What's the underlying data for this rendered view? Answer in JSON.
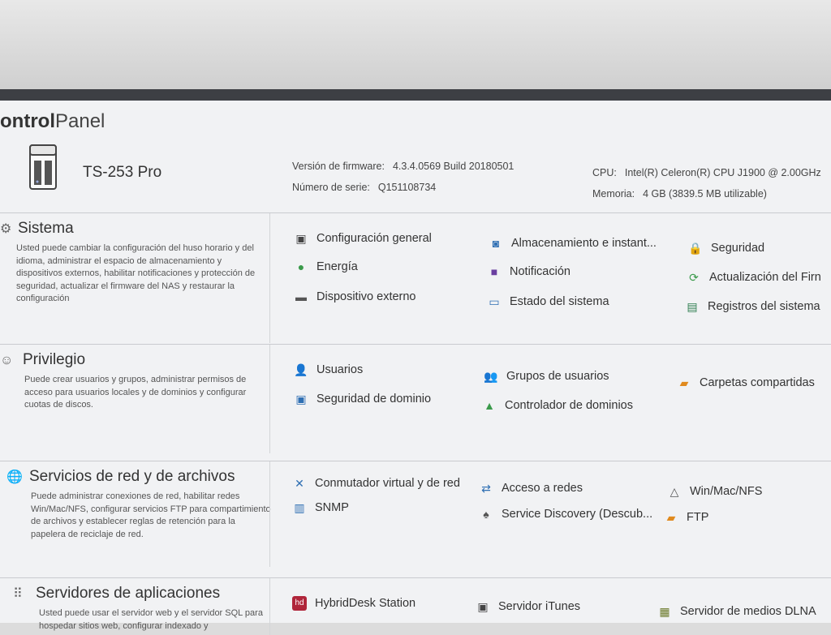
{
  "app": {
    "title_bold": "ontrol",
    "title_rest": "Panel"
  },
  "device": {
    "model": "TS-253 Pro",
    "firmware_label": "Versión de firmware:",
    "firmware_value": "4.3.4.0569 Build 20180501",
    "serial_label": "Número de serie:",
    "serial_value": "Q151108734",
    "cpu_label": "CPU:",
    "cpu_value": "Intel(R) Celeron(R) CPU J1900 @ 2.00GHz",
    "memory_label": "Memoria:",
    "memory_value": "4 GB (3839.5 MB utilizable)"
  },
  "sections": {
    "sistema": {
      "title": "Sistema",
      "desc": "Usted puede cambiar la configuración del huso horario y del idioma, administrar el espacio de almacenamiento y dispositivos externos, habilitar notificaciones y protección de seguridad, actualizar el firmware del NAS y restaurar la configuración",
      "items": [
        "Configuración general",
        "Almacenamiento e instant...",
        "Seguridad",
        "Energía",
        "Notificación",
        "Actualización del Firn",
        "Dispositivo externo",
        "Estado del sistema",
        "Registros del sistema"
      ]
    },
    "privilegio": {
      "title": "Privilegio",
      "desc": "Puede crear usuarios y grupos, administrar permisos de acceso para usuarios locales y de dominios y configurar cuotas de discos.",
      "items": [
        "Usuarios",
        "Grupos de usuarios",
        "Carpetas compartidas",
        "Seguridad de dominio",
        "Controlador de dominios"
      ]
    },
    "red": {
      "title": "Servicios de red y de archivos",
      "desc": "Puede administrar conexiones de red, habilitar redes Win/Mac/NFS, configurar servicios FTP para compartimiento de archivos y establecer reglas de retención para la papelera de reciclaje de red.",
      "items": [
        "Conmutador virtual y de red",
        "Acceso a redes",
        "Win/Mac/NFS",
        "SNMP",
        "Service Discovery (Descub...",
        "FTP"
      ]
    },
    "aplicaciones": {
      "title": "Servidores de aplicaciones",
      "desc": "Usted puede usar el servidor web y el servidor SQL para hospedar sitios web, configurar indexado y",
      "items": [
        "HybridDesk Station",
        "Servidor iTunes",
        "Servidor de medios DLNA"
      ]
    }
  },
  "colors": {
    "chrome_dark": "#3d3f44",
    "panel_bg": "#f1f2f4",
    "accent_blue": "#2f6fb3",
    "green": "#3a9a4a",
    "purple": "#6a3fa0",
    "orange": "#e08a1e",
    "hybrid_red": "#b0253a"
  }
}
